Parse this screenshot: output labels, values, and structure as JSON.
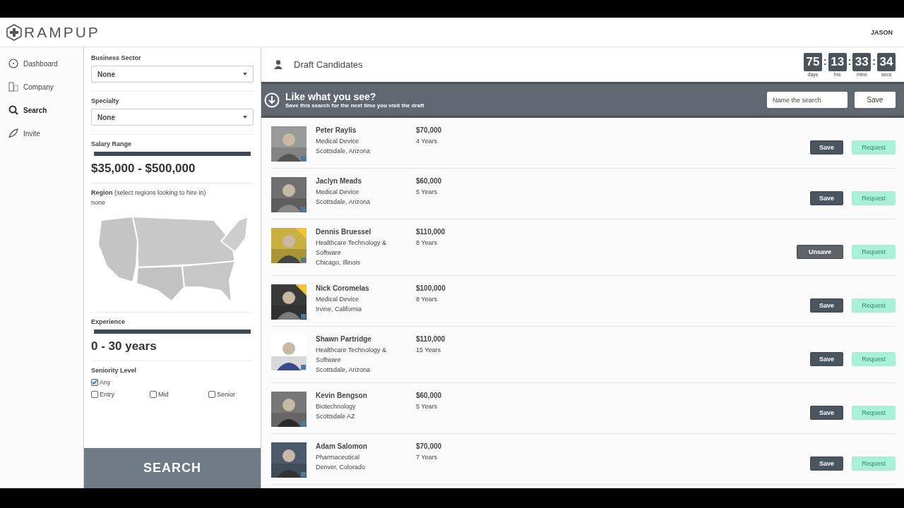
{
  "header": {
    "logo": "RAMPUP",
    "user": "JASON"
  },
  "nav": [
    {
      "label": "Dashboard",
      "kind": "dashboard",
      "selected": false
    },
    {
      "label": "Company",
      "kind": "company",
      "selected": false
    },
    {
      "label": "Search",
      "kind": "search",
      "selected": true
    },
    {
      "label": "Invite",
      "kind": "invite",
      "selected": false
    }
  ],
  "filters": {
    "business_sector": {
      "label": "Business Sector",
      "value": "None"
    },
    "specialty": {
      "label": "Specialty",
      "value": "None"
    },
    "salary": {
      "label": "Salary Range",
      "level": 1,
      "reading": "$35,000 - $500,000"
    },
    "region": {
      "label": "Region",
      "hint": "(select regions looking to hire in)",
      "value": "none"
    },
    "experience": {
      "label": "Experience",
      "level": 1,
      "reading": "0 - 30 years"
    },
    "seniority": {
      "label": "Seniority Level",
      "options": [
        {
          "label": "Any",
          "checked": true
        },
        {
          "label": "Entry",
          "checked": false
        },
        {
          "label": "Mid",
          "checked": false
        },
        {
          "label": "Senior",
          "checked": false
        }
      ]
    },
    "search_button": "SEARCH"
  },
  "main": {
    "title": "Draft Candidates",
    "countdown": [
      {
        "value": "75",
        "unit": "days"
      },
      {
        "separator": ":",
        "value": "13",
        "unit": "hrs"
      },
      {
        "separator": ":",
        "value": "33",
        "unit": "mins"
      },
      {
        "separator": ":",
        "value": "34",
        "unit": "secs"
      }
    ],
    "save_bar": {
      "title": "Like what you see?",
      "subtitle": "Save this search for the next time you visit the draft",
      "placeholder": "Name the search",
      "button": "Save"
    },
    "candidates": [
      {
        "name": "Peter Raylis",
        "sector": "Medical Device",
        "location": "Scottsdale, Arizona",
        "salary": "$70,000",
        "experience": "4 Years",
        "flagged": false,
        "saved": false,
        "action": "Save",
        "request": "Request",
        "request_disabled": true
      },
      {
        "name": "Jaclyn Meads",
        "sector": "Medical Device",
        "location": "Scottsdale, Arizona",
        "salary": "$60,000",
        "experience": "5 Years",
        "flagged": false,
        "saved": false,
        "action": "Save",
        "request": "Request",
        "request_disabled": true
      },
      {
        "name": "Dennis Bruessel",
        "sector": "Healthcare Technology & Software",
        "location": "Chicago, Illinois",
        "salary": "$110,000",
        "experience": "8 Years",
        "flagged": true,
        "saved": true,
        "action": "Unsave",
        "request": "Request",
        "request_disabled": true
      },
      {
        "name": "Nick Coromelas",
        "sector": "Medical Device",
        "location": "Irvine, California",
        "salary": "$100,000",
        "experience": "8 Years",
        "flagged": true,
        "saved": false,
        "action": "Save",
        "request": "Request",
        "request_disabled": true
      },
      {
        "name": "Shawn Partridge",
        "sector": "Healthcare Technology & Software",
        "location": "Scottsdale, Arizona",
        "salary": "$110,000",
        "experience": "15 Years",
        "flagged": false,
        "saved": false,
        "action": "Save",
        "request": "Request",
        "request_disabled": true
      },
      {
        "name": "Kevin Bengson",
        "sector": "Biotechnology",
        "location": "Scottsdale AZ",
        "salary": "$60,000",
        "experience": "5 Years",
        "flagged": false,
        "saved": false,
        "action": "Save",
        "request": "Request",
        "request_disabled": true
      },
      {
        "name": "Adam Salomon",
        "sector": "Pharmaceutical",
        "location": "Denver, Colorado",
        "salary": "$70,000",
        "experience": "7 Years",
        "flagged": false,
        "saved": false,
        "action": "Save",
        "request": "Request",
        "request_disabled": true
      }
    ]
  }
}
